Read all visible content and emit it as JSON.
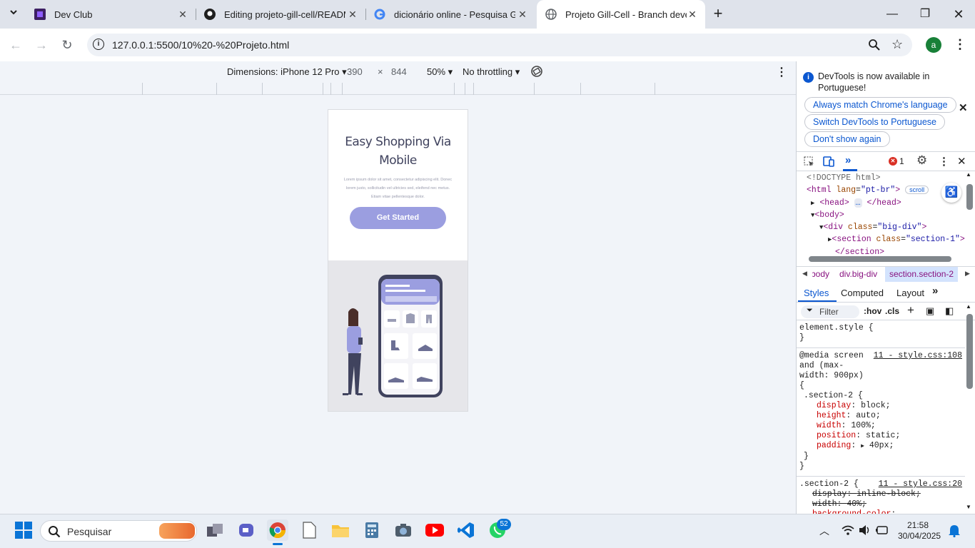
{
  "tabs": [
    {
      "title": "Dev Club"
    },
    {
      "title": "Editing projeto-gill-cell/READM"
    },
    {
      "title": "dicionário online - Pesquisa Go"
    },
    {
      "title": "Projeto Gill-Cell - Branch develo"
    }
  ],
  "address": {
    "url": "127.0.0.1:5500/10%20-%20Projeto.html"
  },
  "profile_initial": "a",
  "device_toolbar": {
    "device": "Dimensions: iPhone 12 Pro",
    "width": "390",
    "times": "×",
    "height": "844",
    "zoom": "50%",
    "throttling": "No throttling"
  },
  "page": {
    "title": "Easy Shopping Via Mobile",
    "body": "Lorem ipsum dolor sit amet, consectetur adipiscing elit. Donec lorem justo, sollicitudin vel ultricies sed, eleifend nec metus. Etiam vitae pellentesque dolor.",
    "button": "Get Started"
  },
  "devtools": {
    "notice": "DevTools is now available in Portuguese!",
    "btn_match": "Always match Chrome's language",
    "btn_switch": "Switch DevTools to Portuguese",
    "btn_dont_show": "Don't show again",
    "error_count": "1",
    "dom": {
      "doctype": "<!DOCTYPE html>",
      "html_open": "<html",
      "html_attr": "lang",
      "html_val": "\"pt-br\"",
      "html_close": ">",
      "scroll_badge": "scroll",
      "head_open": "<head>",
      "ellipsis": "…",
      "head_close": "</head>",
      "body_open": "<body>",
      "div_open": "<div",
      "div_attr": "class",
      "div_val": "\"big-div\"",
      "section_open": "<section",
      "section_attr": "class",
      "section_val": "\"section-1\"",
      "section_close": "</section>"
    },
    "breadcrumbs": [
      "body",
      "div.big-div",
      "section.section-2"
    ],
    "subtabs": [
      "Styles",
      "Computed",
      "Layout"
    ],
    "filter_placeholder": "Filter",
    "hov": ":hov",
    "cls": ".cls",
    "styles": {
      "element_style": "element.style {",
      "close_brace": "}",
      "media_l1": "@media screen",
      "media_l2": "and (max-",
      "media_l3": "width: 900px)",
      "open_brace": "{",
      "media_src": "11 - style.css:108",
      "selector": ".section-2 {",
      "decls": [
        {
          "prop": "display",
          "val": "block;"
        },
        {
          "prop": "height",
          "val": "auto;"
        },
        {
          "prop": "width",
          "val": "100%;"
        },
        {
          "prop": "position",
          "val": "static;"
        },
        {
          "prop": "padding",
          "val": "40px;"
        }
      ],
      "rule2_selector": ".section-2 {",
      "rule2_src": "11 - style.css:20",
      "rule2_decls": [
        {
          "prop": "display",
          "val": "inline-block;"
        },
        {
          "prop": "width",
          "val": "40%;"
        },
        {
          "prop": "background-color",
          "val": ""
        }
      ]
    }
  },
  "taskbar": {
    "search_placeholder": "Pesquisar",
    "whatsapp_badge": "52",
    "time": "21:58",
    "date": "30/04/2025"
  },
  "colors": {
    "accent": "#0b57d0",
    "cta": "#9b9ee0",
    "heading": "#40435e"
  }
}
